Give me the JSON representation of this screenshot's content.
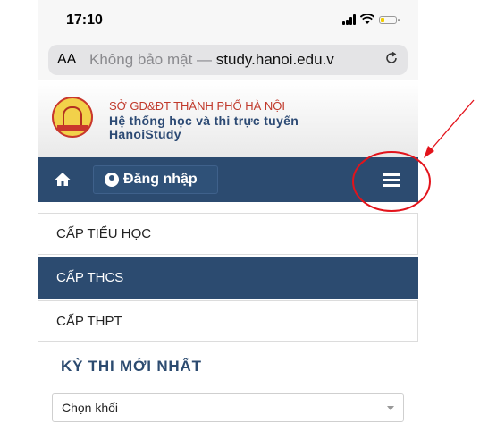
{
  "status_bar": {
    "time": "17:10"
  },
  "address_bar": {
    "aa_label": "AA",
    "prefix": "Không bảo mật —",
    "domain": "study.hanoi.edu.v"
  },
  "site_header": {
    "org": "SỞ GD&ĐT THÀNH PHỐ HÀ NỘI",
    "system_line1": "Hệ thống học và thi trực tuyến",
    "system_line2": "HanoiStudy"
  },
  "navbar": {
    "login_label": "Đăng nhập"
  },
  "menu": {
    "items": [
      {
        "label": "CẤP TIỂU HỌC"
      },
      {
        "label": "CẤP THCS"
      },
      {
        "label": "CẤP THPT"
      }
    ]
  },
  "exams": {
    "title": "KỲ THI MỚI NHẤT",
    "grade_select": "Chọn khối"
  },
  "colors": {
    "navbar": "#2c4b70",
    "annotation": "#e3131b"
  },
  "icons": {
    "home": "home-icon",
    "user": "user-circle-icon",
    "menu": "hamburger-menu-icon",
    "reload": "reload-icon"
  }
}
